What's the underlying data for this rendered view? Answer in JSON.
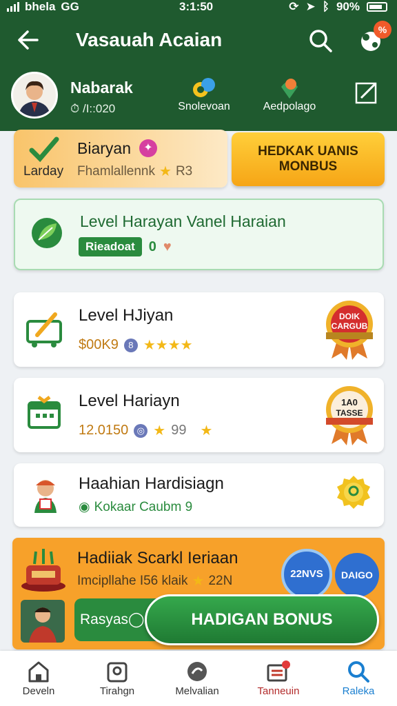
{
  "status": {
    "carrier": "bhela",
    "network": "GG",
    "time": "3:1:50",
    "battery": "90%"
  },
  "header": {
    "title": "Vasauah Acaian",
    "gift_badge": "%",
    "user_name": "Nabarak",
    "user_sub": "⏱ /I::020",
    "btn1": "Snolevoan",
    "btn2": "Aedpolago"
  },
  "daily": {
    "title": "Biaryan",
    "subtitle": "Fhamlallennk",
    "rating": "R3",
    "side_label": "Larday",
    "claim_line1": "HEDKAK UANIS",
    "claim_line2": "MONBUS"
  },
  "level_card": {
    "title": "Level Harayan Vanel Haraian",
    "tag": "Rieadoat",
    "count": "0"
  },
  "items": [
    {
      "title": "Level HJiyan",
      "value": "$00K9",
      "badge_line1": "DOIK",
      "badge_line2": "CARGUB"
    },
    {
      "title": "Level Hariayn",
      "value": "12.0150",
      "extra": "99",
      "badge_line1": "1A0",
      "badge_line2": "TASSE"
    },
    {
      "title": "Haahian Hardisiagn",
      "value": "Kokaar Caubm 9"
    }
  ],
  "promo": {
    "title": "Hadiiak Scarkl Ieriaan",
    "subtitle": "Imcipllahe I56 klaik",
    "rating": "22N",
    "chip1": "22NVS",
    "chip2": "DAIGO",
    "left_btn": "Rasyas◯",
    "main_btn": "HADIGAN BONUS"
  },
  "nav": [
    {
      "label": "Develn"
    },
    {
      "label": "Tirahgn"
    },
    {
      "label": "Melvalian"
    },
    {
      "label": "Tanneuin"
    },
    {
      "label": "Raleka"
    }
  ],
  "colors": {
    "header_bg": "#1f5a2f",
    "accent_green": "#2a8b3e",
    "gold": "#f6a516",
    "promo_orange": "#f7a12a",
    "active_nav": "#1a7fd0"
  }
}
